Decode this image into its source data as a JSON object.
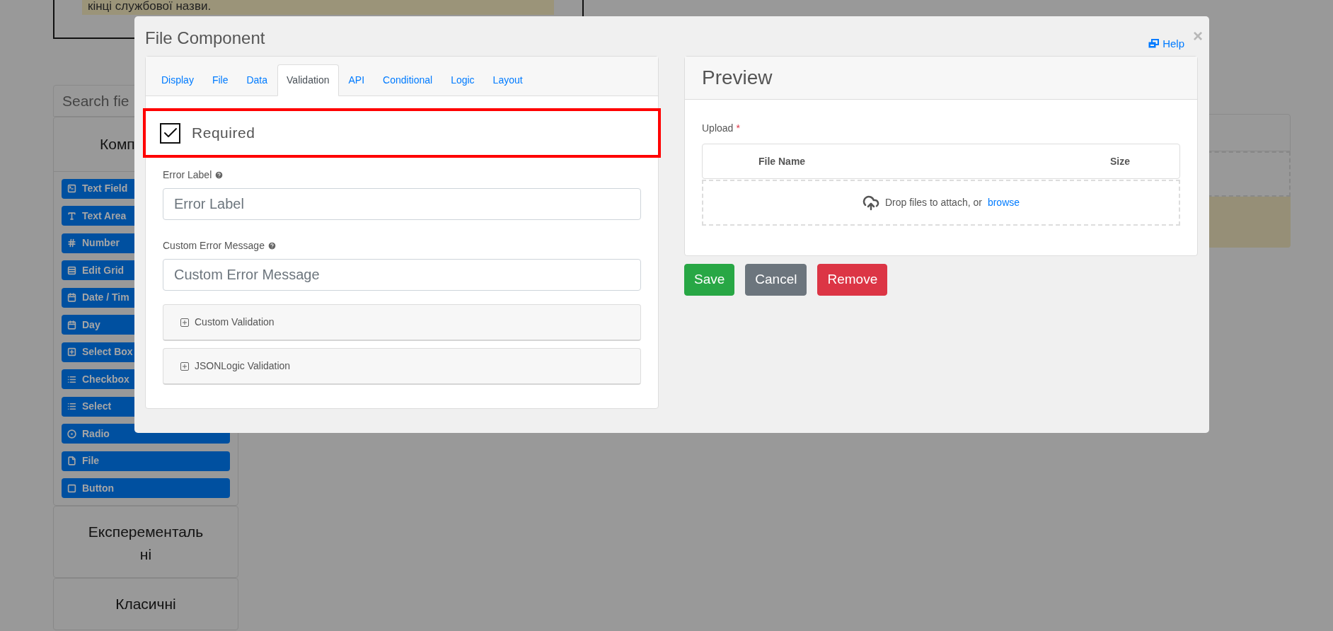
{
  "background": {
    "note": "кінці службової назви.",
    "search": {
      "placeholder": "Search fie"
    },
    "groups": [
      {
        "title": "Комп",
        "expanded": true,
        "items": [
          "Text Field",
          "Text Area",
          "Number",
          "Edit Grid",
          "Date / Tim",
          "Day",
          "Select Box",
          "Checkbox",
          "Select",
          "Radio",
          "File",
          "Button"
        ]
      },
      {
        "title": "Експерементальні",
        "expanded": false
      },
      {
        "title": "Класичні",
        "expanded": false
      }
    ]
  },
  "dialog": {
    "title": "File Component",
    "help": "Help",
    "close": "×",
    "tabs": [
      {
        "label": "Display",
        "selected": false
      },
      {
        "label": "File",
        "selected": false
      },
      {
        "label": "Data",
        "selected": false
      },
      {
        "label": "Validation",
        "selected": true
      },
      {
        "label": "API",
        "selected": false
      },
      {
        "label": "Conditional",
        "selected": false
      },
      {
        "label": "Logic",
        "selected": false
      },
      {
        "label": "Layout",
        "selected": false
      }
    ],
    "required": {
      "label": "Required",
      "checked": true
    },
    "fields": [
      {
        "label": "Error Label",
        "placeholder": "Error Label"
      },
      {
        "label": "Custom Error Message",
        "placeholder": "Custom Error Message"
      }
    ],
    "panels": [
      {
        "title": "Custom Validation",
        "expanded": false
      },
      {
        "title": "JSONLogic Validation",
        "expanded": false
      }
    ],
    "preview": {
      "title": "Preview",
      "upload_label": "Upload",
      "required_mark": "*",
      "columns": [
        "File Name",
        "Size"
      ],
      "drop_text": "Drop files to attach, or",
      "browse": "browse"
    },
    "buttons": [
      {
        "label": "Save",
        "kind": "success"
      },
      {
        "label": "Cancel",
        "kind": "secondary"
      },
      {
        "label": "Remove",
        "kind": "danger"
      }
    ]
  }
}
